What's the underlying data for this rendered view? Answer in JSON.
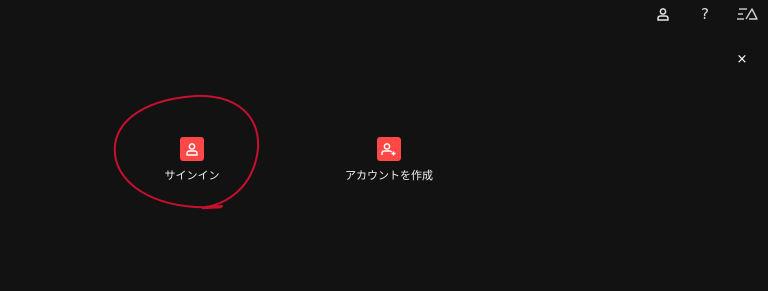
{
  "topbar": {
    "account_icon": "user-icon",
    "help_label": "?",
    "logo_label": "EA"
  },
  "dialog": {
    "close_label": "×",
    "options": {
      "sign_in": {
        "label": "サインイン",
        "icon": "user-icon"
      },
      "create_account": {
        "label": "アカウントを作成",
        "icon": "user-plus-icon"
      }
    }
  },
  "colors": {
    "background": "#121212",
    "accent": "#ff4747",
    "annotation": "#c8102e"
  }
}
